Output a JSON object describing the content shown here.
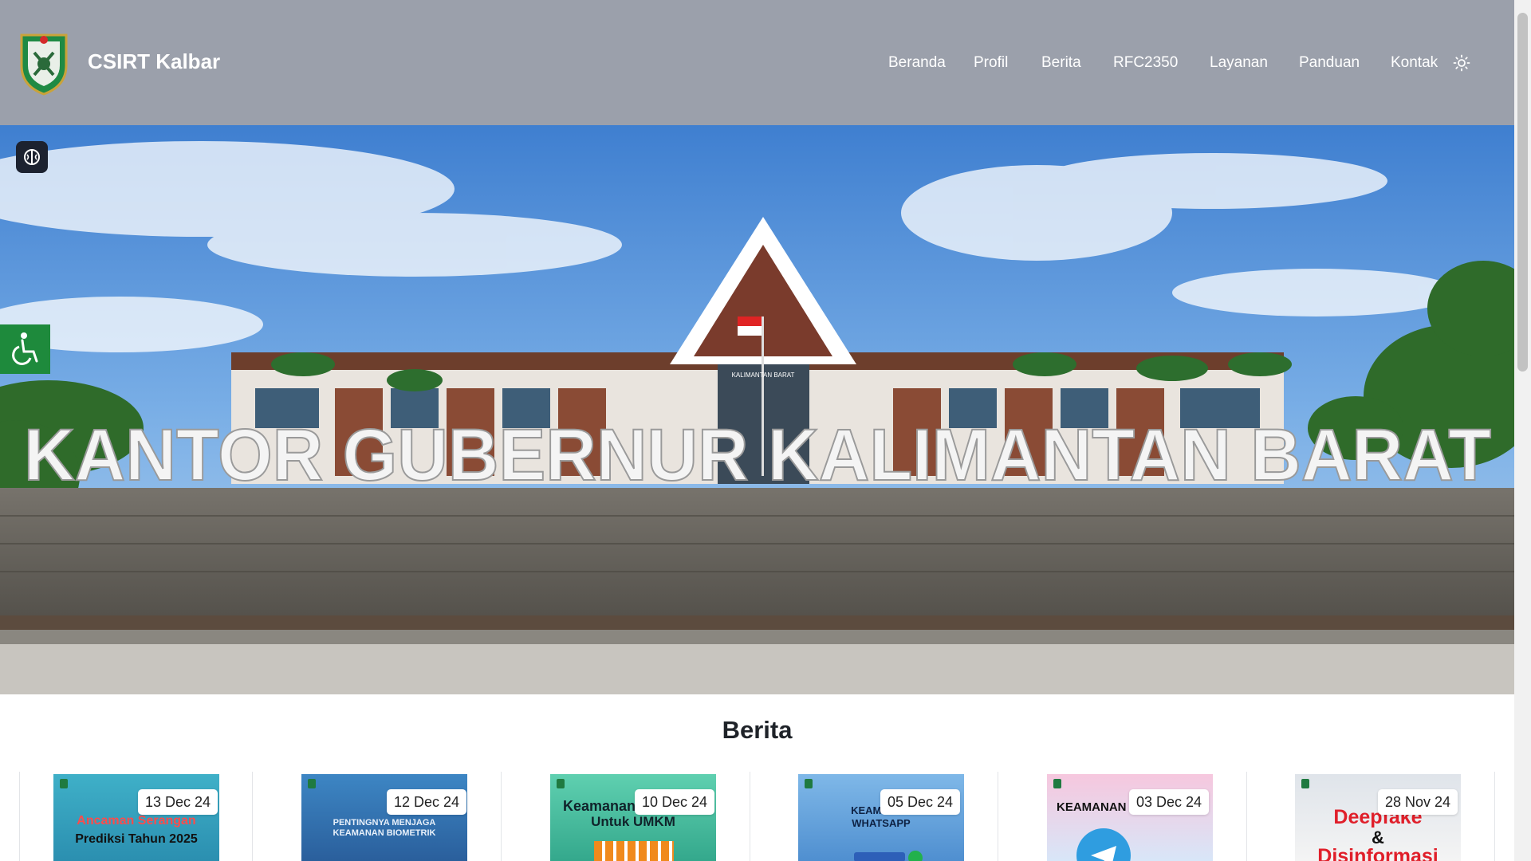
{
  "header": {
    "brand": "CSIRT Kalbar",
    "nav": [
      "Beranda",
      "Profil",
      "Berita",
      "RFC2350",
      "Layanan",
      "Panduan",
      "Kontak"
    ]
  },
  "hero": {
    "sign_text": "KANTOR GUBERNUR KALIMANTAN BARAT",
    "building_text": "KALIMANTAN BARAT"
  },
  "section": {
    "title": "Berita"
  },
  "news": [
    {
      "date": "13 Dec 24",
      "caption_1": "Ancaman Serangan",
      "caption_2": "Prediksi Tahun 2025"
    },
    {
      "date": "12 Dec 24",
      "caption_1": "PENTINGNYA MENJAGA",
      "caption_2": "KEAMANAN BIOMETRIK"
    },
    {
      "date": "10 Dec 24",
      "caption_1": "Keamanan",
      "caption_2": "Untuk UMKM"
    },
    {
      "date": "05 Dec 24",
      "caption_1": "KEAMANAN",
      "caption_2": "WHATSAPP"
    },
    {
      "date": "03 Dec 24",
      "caption_1": "KEAMANAN",
      "caption_2": ""
    },
    {
      "date": "28 Nov 24",
      "caption_1": "Deepfake",
      "caption_2": "&",
      "caption_3": "Disinformasi"
    }
  ],
  "icons": {
    "logo": "kalbar-crest",
    "theme_toggle": "sun-icon",
    "assistant": "brain-icon",
    "accessibility": "wheelchair-icon"
  },
  "colors": {
    "header_bg": "#9ba0ab",
    "accessibility_green": "#1e8a3c",
    "text_dark": "#1f2329"
  }
}
